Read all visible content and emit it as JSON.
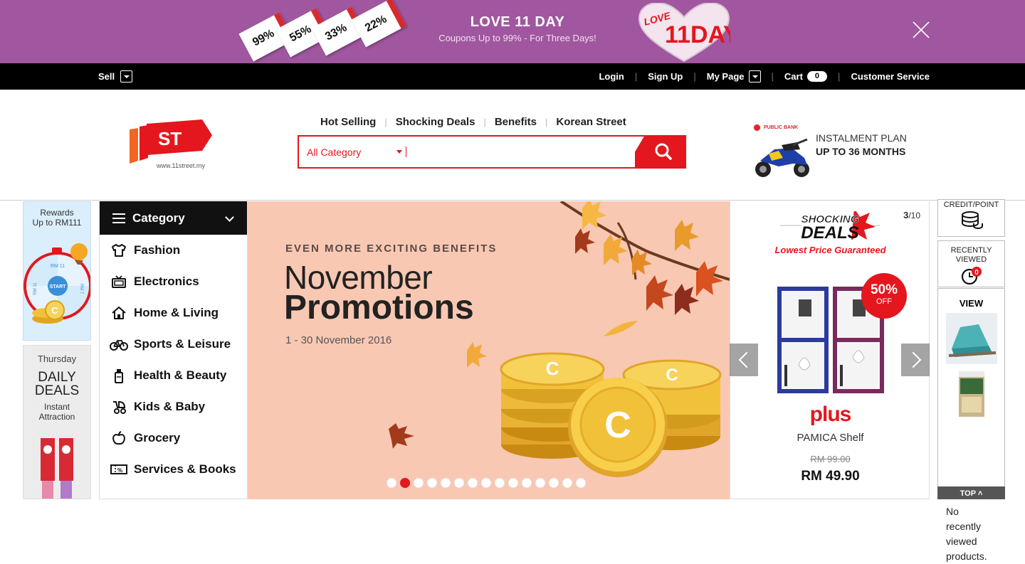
{
  "promo": {
    "coupons": [
      "99%",
      "55%",
      "33%",
      "22%"
    ],
    "title": "LOVE 11 DAY",
    "subtitle": "Coupons Up to 99% - For Three Days!",
    "heart_small": "LOVE",
    "heart_big": "11DAY"
  },
  "utilbar": {
    "sell": "Sell",
    "login": "Login",
    "signup": "Sign Up",
    "mypage": "My Page",
    "cart": "Cart",
    "cart_count": "0",
    "customer_service": "Customer Service",
    "sep": "|"
  },
  "header": {
    "logo_text": "ST",
    "logo_url": "www.11street.my",
    "quicklinks": [
      "Hot Selling",
      "Shocking Deals",
      "Benefits",
      "Korean Street"
    ],
    "search_category": "All Category",
    "search_value": ""
  },
  "instalment": {
    "bank": "PUBLIC BANK",
    "line1": "INSTALMENT PLAN",
    "line2": "UP TO 36 MONTHS"
  },
  "rewards": {
    "label1": "Rewards",
    "label2": "Up to RM111",
    "wheel_start": "START",
    "wheel_top": "RM 11",
    "wheel_left": "RM 11",
    "wheel_right": "RM 7"
  },
  "daily": {
    "day": "Thursday",
    "title1": "DAILY",
    "title2": "DEALS",
    "sub1": "Instant",
    "sub2": "Attraction"
  },
  "category": {
    "title": "Category",
    "items": [
      "Fashion",
      "Electronics",
      "Home & Living",
      "Sports & Leisure",
      "Health & Beauty",
      "Kids & Baby",
      "Grocery",
      "Services & Books"
    ]
  },
  "hero": {
    "kicker": "EVEN MORE EXCITING BENEFITS",
    "headline1": "November",
    "headline2": "Promotions",
    "dates": "1 - 30 November 2016",
    "coin_letter": "C",
    "slide_count": 15,
    "active_slide": 2
  },
  "deals": {
    "page_current": "3",
    "page_total": "/10",
    "tag1": "SHOCKING",
    "tag2": "DEALS",
    "tagline": "Lowest Price Guaranteed",
    "discount": "50%",
    "discount_off": "OFF",
    "brand": "plus",
    "product_name": "PAMICA Shelf",
    "old_price": "RM 99.00",
    "new_price": "RM 49.90"
  },
  "rightbar": {
    "credit": "CREDIT/POINT",
    "recent1": "RECENTLY",
    "recent2": "VIEWED",
    "recent_count": "0",
    "view": "VIEW",
    "none1": "No",
    "none2": "recently",
    "none3": "viewed",
    "none4": "products.",
    "top": "TOP"
  },
  "colors": {
    "promo_bg": "#a0579f",
    "brand_red": "#e3171d",
    "hero_bg": "#f8c8b3",
    "coin_gold": "#f2c13a"
  }
}
